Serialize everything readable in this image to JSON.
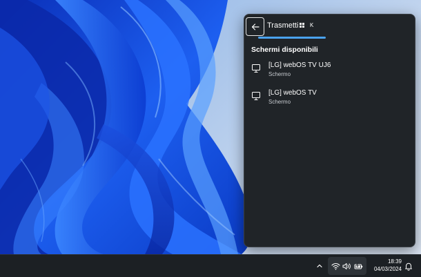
{
  "cast_panel": {
    "title": "Trasmetti",
    "shortcut_key": "K",
    "section_heading": "Schermi disponibili",
    "devices": [
      {
        "name": "[LG] webOS TV UJ6",
        "type": "Schermo",
        "icon": "monitor-icon"
      },
      {
        "name": "[LG] webOS TV",
        "type": "Schermo",
        "icon": "monitor-icon"
      }
    ],
    "accent_color": "#4aa3f0"
  },
  "taskbar": {
    "time": "18:39",
    "date": "04/03/2024",
    "tray_icons": [
      "chevron-up-icon",
      "wifi-icon",
      "volume-icon",
      "battery-charging-icon",
      "notification-bell-icon"
    ]
  },
  "colors": {
    "panel_background": "#202428",
    "taskbar_background": "#1c2024",
    "wallpaper_blue": "#1a5be0"
  }
}
